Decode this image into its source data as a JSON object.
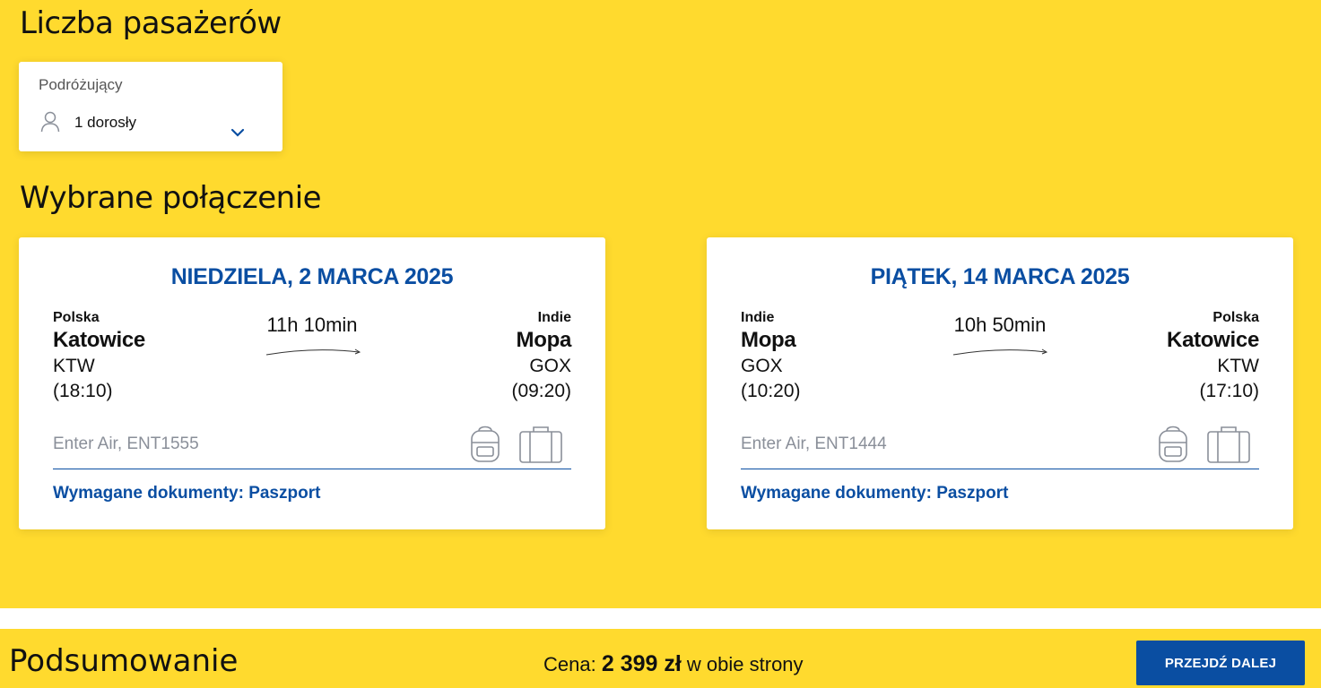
{
  "passengers_section": {
    "title": "Liczba pasażerów",
    "label": "Podróżujący",
    "value": "1 dorosły"
  },
  "connection_section": {
    "title": "Wybrane połączenie"
  },
  "outbound": {
    "date": "NIEDZIELA, 2 MARCA 2025",
    "from_country": "Polska",
    "from_city": "Katowice",
    "from_code": "KTW",
    "from_time": "(18:10)",
    "duration": "11h 10min",
    "to_country": "Indie",
    "to_city": "Mopa",
    "to_code": "GOX",
    "to_time": "(09:20)",
    "flight": "Enter Air, ENT1555",
    "documents": "Wymagane dokumenty: Paszport",
    "icons": [
      "backpack-icon",
      "suitcase-icon"
    ]
  },
  "return": {
    "date": "PIĄTEK, 14 MARCA 2025",
    "from_country": "Indie",
    "from_city": "Mopa",
    "from_code": "GOX",
    "from_time": "(10:20)",
    "duration": "10h 50min",
    "to_country": "Polska",
    "to_city": "Katowice",
    "to_code": "KTW",
    "to_time": "(17:10)",
    "flight": "Enter Air, ENT1444",
    "documents": "Wymagane dokumenty: Paszport",
    "icons": [
      "backpack-icon",
      "suitcase-icon"
    ]
  },
  "summary": {
    "title": "Podsumowanie",
    "price_prefix": "Cena:",
    "price_value": "2 399 zł",
    "price_suffix": "w obie strony",
    "next_button": "PRZEJDŹ DALEJ"
  },
  "colors": {
    "background_yellow": "#FFDA2E",
    "accent_blue": "#0A4EA2"
  }
}
